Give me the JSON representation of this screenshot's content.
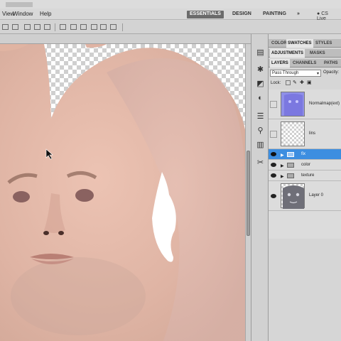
{
  "menu": {
    "items": [
      "View",
      "Window",
      "Help"
    ]
  },
  "workspaces": {
    "essentials": "ESSENTIALS",
    "design": "DESIGN",
    "painting": "PAINTING",
    "more": "»",
    "cs_live": "CS Live"
  },
  "panels": {
    "tabs_top": [
      "COLOR",
      "SWATCHES",
      "STYLES"
    ],
    "tabs_mid": [
      "ADJUSTMENTS",
      "MASKS"
    ],
    "tabs_layers": [
      "LAYERS",
      "CHANNELS",
      "PATHS"
    ],
    "blend_mode": "Pass Through",
    "opacity_label": "Opacity:",
    "lock_label": "Lock:",
    "layers": [
      {
        "name": "Normalmap(ext)",
        "visible": false,
        "kind": "thumb-blue"
      },
      {
        "name": "lins",
        "visible": false,
        "kind": "thumb-empty"
      },
      {
        "name": "fix",
        "visible": true,
        "kind": "group",
        "selected": true
      },
      {
        "name": "color",
        "visible": true,
        "kind": "group"
      },
      {
        "name": "texture",
        "visible": true,
        "kind": "group"
      },
      {
        "name": "Layer 0",
        "visible": true,
        "kind": "thumb-face"
      }
    ]
  }
}
